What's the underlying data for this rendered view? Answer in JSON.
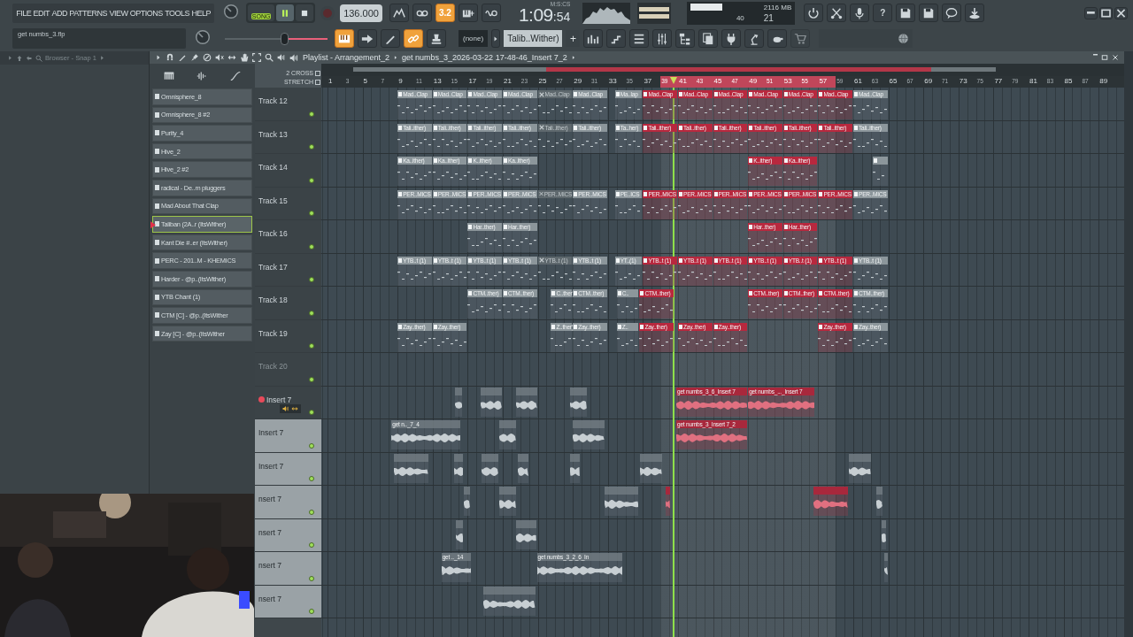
{
  "menu": [
    "FILE",
    "EDIT",
    "ADD",
    "PATTERNS",
    "VIEW",
    "OPTIONS",
    "TOOLS",
    "HELP"
  ],
  "hint_panel": {
    "text": "get numbs_3.flp"
  },
  "transport": {
    "song_label": "SONG",
    "song_mode": true,
    "playing": true,
    "recording": false,
    "tempo": "136.000"
  },
  "toolbar_top": [
    {
      "kind": "graph",
      "on": false
    },
    {
      "kind": "tape",
      "on": false
    },
    {
      "kind": "text",
      "label": "3.2",
      "on": true
    },
    {
      "kind": "keys",
      "on": false
    },
    {
      "kind": "wave",
      "on": false
    }
  ],
  "clock": {
    "time": "1:09",
    "seconds": ":54",
    "unit": "M:S:CS"
  },
  "monitor": {
    "polyphony": "40",
    "memory": "2116 MB",
    "cpu": "21"
  },
  "toolbar_right": [
    {
      "kind": "refresh"
    },
    {
      "kind": "cut"
    },
    {
      "kind": "mic"
    },
    {
      "kind": "text",
      "label": "?"
    },
    {
      "kind": "disk"
    },
    {
      "kind": "disk"
    },
    {
      "kind": "chat"
    },
    {
      "kind": "download"
    }
  ],
  "master_slider": {
    "level": 0.58
  },
  "toolbar_second": [
    {
      "kind": "piano",
      "on": true
    },
    {
      "kind": "arrow",
      "on": false
    },
    {
      "kind": "pencil",
      "on": false
    },
    {
      "kind": "link",
      "on": true
    },
    {
      "kind": "stamp",
      "on": false
    }
  ],
  "pattern_selector": {
    "value": "(none)"
  },
  "channel_selector": {
    "value": "Talib..Wither)",
    "add": "+"
  },
  "browser": {
    "title": "Browser - Snap 1"
  },
  "channels": [
    {
      "name": "Omnisphere_8",
      "selected": false
    },
    {
      "name": "Omnisphere_8 #2",
      "selected": false
    },
    {
      "name": "Purity_4",
      "selected": false
    },
    {
      "name": "Hive_2",
      "selected": false
    },
    {
      "name": "Hive_2 #2",
      "selected": false
    },
    {
      "name": "radical - De..m pluggers",
      "selected": false
    },
    {
      "name": "Mad About That Clap",
      "selected": false
    },
    {
      "name": "Taliban (2A..r (ItsWither)",
      "selected": true
    },
    {
      "name": "Kant Die #..er (ItsWither)",
      "selected": false
    },
    {
      "name": "PERC - 201..M - KHEMICS",
      "selected": false
    },
    {
      "name": "Harder - @p..(ItsWither)",
      "selected": false
    },
    {
      "name": "YTB Chant (1)",
      "selected": false
    },
    {
      "name": "CTM [C] - @p..(ItsWither",
      "selected": false
    },
    {
      "name": "Zay [C] - @p..(ItsWither",
      "selected": false
    }
  ],
  "playlist": {
    "title": "Playlist - Arrangement_2",
    "path": "get numbs_3_2026-03-22 17-48-46_Insert 7_2",
    "header_options": [
      {
        "label": "2 CROSS",
        "checked": false
      },
      {
        "label": "STRETCH",
        "checked": false
      }
    ],
    "ruler": [
      {
        "label": "1",
        "in_loop": false
      },
      {
        "label": "3",
        "in_loop": false
      },
      {
        "label": "5",
        "in_loop": false
      },
      {
        "label": "7",
        "in_loop": false
      },
      {
        "label": "9",
        "in_loop": false
      },
      {
        "label": "11",
        "in_loop": false
      },
      {
        "label": "13",
        "in_loop": false
      },
      {
        "label": "15",
        "in_loop": false
      },
      {
        "label": "17",
        "in_loop": false
      },
      {
        "label": "19",
        "in_loop": false
      },
      {
        "label": "21",
        "in_loop": false
      },
      {
        "label": "23",
        "in_loop": false
      },
      {
        "label": "25",
        "in_loop": false
      },
      {
        "label": "27",
        "in_loop": false
      },
      {
        "label": "29",
        "in_loop": false
      },
      {
        "label": "31",
        "in_loop": false
      },
      {
        "label": "33",
        "in_loop": false
      },
      {
        "label": "35",
        "in_loop": false
      },
      {
        "label": "37",
        "in_loop": false
      },
      {
        "label": "39",
        "in_loop": true
      },
      {
        "label": "41",
        "in_loop": true
      },
      {
        "label": "43",
        "in_loop": true
      },
      {
        "label": "45",
        "in_loop": true
      },
      {
        "label": "47",
        "in_loop": true
      },
      {
        "label": "49",
        "in_loop": true
      },
      {
        "label": "51",
        "in_loop": true
      },
      {
        "label": "53",
        "in_loop": true
      },
      {
        "label": "55",
        "in_loop": true
      },
      {
        "label": "57",
        "in_loop": true
      },
      {
        "label": "59",
        "in_loop": false
      },
      {
        "label": "61",
        "in_loop": false
      },
      {
        "label": "63",
        "in_loop": false
      },
      {
        "label": "65",
        "in_loop": false
      },
      {
        "label": "67",
        "in_loop": false
      },
      {
        "label": "69",
        "in_loop": false
      },
      {
        "label": "71",
        "in_loop": false
      },
      {
        "label": "73",
        "in_loop": false
      },
      {
        "label": "75",
        "in_loop": false
      },
      {
        "label": "77",
        "in_loop": false
      },
      {
        "label": "79",
        "in_loop": false
      },
      {
        "label": "81",
        "in_loop": false
      },
      {
        "label": "83",
        "in_loop": false
      },
      {
        "label": "85",
        "in_loop": false
      },
      {
        "label": "87",
        "in_loop": false
      },
      {
        "label": "89",
        "in_loop": false
      }
    ],
    "tracks": [
      {
        "name": "Track 12",
        "kind": "pattern",
        "enabled": true,
        "selected": false,
        "armed": false,
        "clips": [
          {
            "label": "Mad..Clap",
            "selected": false,
            "muted": false
          },
          {
            "label": "Mad..Clap",
            "selected": false,
            "muted": false
          },
          {
            "label": "Mad..Clap",
            "selected": false,
            "muted": false
          },
          {
            "label": "Mad..Clap",
            "selected": false,
            "muted": false
          },
          {
            "label": "Mad..Clap",
            "selected": false,
            "muted": true
          },
          {
            "label": "Mad..Clap",
            "selected": false,
            "muted": false
          },
          {
            "label": "Ma..lap",
            "selected": false,
            "muted": false
          },
          {
            "label": "Mad..Clap",
            "selected": true,
            "muted": false
          },
          {
            "label": "Mad..Clap",
            "selected": true,
            "muted": false
          },
          {
            "label": "Mad..Clap",
            "selected": true,
            "muted": false
          },
          {
            "label": "Mad..Clap",
            "selected": true,
            "muted": false
          },
          {
            "label": "Mad..Clap",
            "selected": true,
            "muted": false
          },
          {
            "label": "Mad..Clap",
            "selected": true,
            "muted": false
          },
          {
            "label": "Mad..Clap",
            "selected": false,
            "muted": false
          }
        ]
      },
      {
        "name": "Track 13",
        "kind": "pattern",
        "enabled": true,
        "selected": false,
        "armed": false,
        "clips": [
          {
            "label": "Tali..ither)",
            "selected": false,
            "muted": false
          },
          {
            "label": "Tali..ither)",
            "selected": false,
            "muted": false
          },
          {
            "label": "Tali..ither)",
            "selected": false,
            "muted": false
          },
          {
            "label": "Tali..ither)",
            "selected": false,
            "muted": false
          },
          {
            "label": "Tali..ither)",
            "selected": false,
            "muted": true
          },
          {
            "label": "Tali..ither)",
            "selected": false,
            "muted": false
          },
          {
            "label": "Ta..her)",
            "selected": false,
            "muted": false
          },
          {
            "label": "Tali..ither)",
            "selected": true,
            "muted": false
          },
          {
            "label": "Tali..ither)",
            "selected": true,
            "muted": false
          },
          {
            "label": "Tali..ither)",
            "selected": true,
            "muted": false
          },
          {
            "label": "Tali..ither)",
            "selected": true,
            "muted": false
          },
          {
            "label": "Tali..ither)",
            "selected": true,
            "muted": false
          },
          {
            "label": "Tali..ither)",
            "selected": true,
            "muted": false
          },
          {
            "label": "Tali..ither)",
            "selected": false,
            "muted": false
          }
        ]
      },
      {
        "name": "Track 14",
        "kind": "pattern",
        "enabled": true,
        "selected": false,
        "armed": false,
        "clips": [
          {
            "label": "Ka..ither)",
            "selected": false,
            "muted": false
          },
          {
            "label": "Ka..ither)",
            "selected": false,
            "muted": false
          },
          {
            "label": "K..ither)",
            "selected": false,
            "muted": false
          },
          {
            "label": "Ka..ither)",
            "selected": false,
            "muted": false
          },
          {
            "label": "K..ither)",
            "selected": true,
            "muted": false
          },
          {
            "label": "Ka..ither)",
            "selected": true,
            "muted": false
          },
          {
            "selected": false,
            "muted": false
          }
        ]
      },
      {
        "name": "Track 15",
        "kind": "pattern",
        "enabled": true,
        "selected": false,
        "armed": false,
        "clips": [
          {
            "label": "PER..MICS",
            "selected": false,
            "muted": false
          },
          {
            "label": "PER..MICS",
            "selected": false,
            "muted": false
          },
          {
            "label": "PER..MICS",
            "selected": false,
            "muted": false
          },
          {
            "label": "PER..MICS",
            "selected": false,
            "muted": false
          },
          {
            "label": "PER..MICS",
            "selected": false,
            "muted": true
          },
          {
            "label": "PER..MICS",
            "selected": false,
            "muted": false
          },
          {
            "label": "PE..ICS",
            "selected": false,
            "muted": false
          },
          {
            "label": "PER..MICS",
            "selected": true,
            "muted": false
          },
          {
            "label": "PER..MICS",
            "selected": true,
            "muted": false
          },
          {
            "label": "PER..MICS",
            "selected": true,
            "muted": false
          },
          {
            "label": "PER..MICS",
            "selected": true,
            "muted": false
          },
          {
            "label": "PER..MICS",
            "selected": true,
            "muted": false
          },
          {
            "label": "PER..MICS",
            "selected": true,
            "muted": false
          },
          {
            "label": "PER..MICS",
            "selected": false,
            "muted": false
          }
        ]
      },
      {
        "name": "Track 16",
        "kind": "pattern",
        "enabled": true,
        "selected": false,
        "armed": false,
        "clips": [
          {
            "label": "Har..ther)",
            "selected": false,
            "muted": false
          },
          {
            "label": "Har..ther)",
            "selected": false,
            "muted": false
          },
          {
            "label": "Har..ther)",
            "selected": true,
            "muted": false
          },
          {
            "label": "Har..ther)",
            "selected": true,
            "muted": false
          }
        ]
      },
      {
        "name": "Track 17",
        "kind": "pattern",
        "enabled": true,
        "selected": false,
        "armed": false,
        "clips": [
          {
            "label": "YTB..t (1)",
            "selected": false,
            "muted": false
          },
          {
            "label": "YTB..t (1)",
            "selected": false,
            "muted": false
          },
          {
            "label": "YTB..t (1)",
            "selected": false,
            "muted": false
          },
          {
            "label": "YTB..t (1)",
            "selected": false,
            "muted": false
          },
          {
            "label": "YTB..t (1)",
            "selected": false,
            "muted": true
          },
          {
            "label": "YTB..t (1)",
            "selected": false,
            "muted": false
          },
          {
            "label": "YT..(1)",
            "selected": false,
            "muted": false
          },
          {
            "label": "YTB..t (1)",
            "selected": true,
            "muted": false
          },
          {
            "label": "YTB..t (1)",
            "selected": true,
            "muted": false
          },
          {
            "label": "YTB..t (1)",
            "selected": true,
            "muted": false
          },
          {
            "label": "YTB..t (1)",
            "selected": true,
            "muted": false
          },
          {
            "label": "YTB..t (1)",
            "selected": true,
            "muted": false
          },
          {
            "label": "YTB..t (1)",
            "selected": true,
            "muted": false
          },
          {
            "label": "YTB..t (1)",
            "selected": false,
            "muted": false
          }
        ]
      },
      {
        "name": "Track 18",
        "kind": "pattern",
        "enabled": true,
        "selected": false,
        "armed": false,
        "clips": [
          {
            "label": "CTM..ther)",
            "selected": false,
            "muted": false
          },
          {
            "label": "CTM..ther)",
            "selected": false,
            "muted": false
          },
          {
            "label": "C..ther)",
            "selected": false,
            "muted": false
          },
          {
            "label": "CTM..ther)",
            "selected": false,
            "muted": false
          },
          {
            "label": "C..",
            "selected": false,
            "muted": false
          },
          {
            "label": "CTM..ther)",
            "selected": true,
            "muted": false
          },
          {
            "label": "CTM..ther)",
            "selected": true,
            "muted": false
          },
          {
            "label": "CTM..ther)",
            "selected": true,
            "muted": false
          },
          {
            "label": "CTM..ther)",
            "selected": true,
            "muted": false
          },
          {
            "label": "CTM..ther)",
            "selected": false,
            "muted": false
          }
        ]
      },
      {
        "name": "Track 19",
        "kind": "pattern",
        "enabled": true,
        "selected": false,
        "armed": false,
        "clips": [
          {
            "label": "Zay..ther)",
            "selected": false,
            "muted": false
          },
          {
            "label": "Zay..ther)",
            "selected": false,
            "muted": false
          },
          {
            "label": "Z..ther)",
            "selected": false,
            "muted": false
          },
          {
            "label": "Zay..ther)",
            "selected": false,
            "muted": false
          },
          {
            "label": "Z..",
            "selected": false,
            "muted": false
          },
          {
            "label": "Zay..ther)",
            "selected": true,
            "muted": false
          },
          {
            "label": "Zay..ther)",
            "selected": true,
            "muted": false
          },
          {
            "label": "Zay..ther)",
            "selected": true,
            "muted": false
          },
          {
            "label": "Zay..ther)",
            "selected": true,
            "muted": false
          },
          {
            "label": "Zay..ther)",
            "selected": false,
            "muted": false
          }
        ]
      },
      {
        "name": "Track 20",
        "enabled": false,
        "selected": false,
        "armed": false
      },
      {
        "name": "Insert 7",
        "kind": "audio",
        "enabled": true,
        "selected": false,
        "armed": true,
        "clips": [
          {
            "selected": false,
            "muted": false
          },
          {
            "selected": false,
            "muted": false
          },
          {
            "selected": false,
            "muted": false
          },
          {
            "selected": false,
            "muted": false
          },
          {
            "label": "get numbs_3_6_Insert 7",
            "selected": true,
            "muted": false
          },
          {
            "label": "get numbs_..._Insert 7",
            "selected": true,
            "muted": false
          }
        ]
      },
      {
        "name": "Insert 7",
        "kind": "audio",
        "enabled": true,
        "selected": true,
        "armed": false,
        "clips": [
          {
            "label": "get n.._7_4",
            "selected": false,
            "muted": false
          },
          {
            "selected": false,
            "muted": false
          },
          {
            "selected": false,
            "muted": false
          },
          {
            "label": "get numbs_3_Insert 7_2",
            "selected": true,
            "muted": false
          }
        ]
      },
      {
        "name": "Insert 7",
        "kind": "audio",
        "enabled": true,
        "selected": true,
        "armed": false,
        "clips": [
          {
            "selected": false,
            "muted": false
          },
          {
            "selected": false,
            "muted": false
          },
          {
            "selected": false,
            "muted": false
          },
          {
            "selected": false,
            "muted": false
          },
          {
            "selected": false,
            "muted": false
          },
          {
            "selected": false,
            "muted": false
          },
          {
            "selected": false,
            "muted": false
          }
        ]
      },
      {
        "name": "nsert 7",
        "kind": "audio",
        "enabled": true,
        "selected": true,
        "armed": false,
        "clips": [
          {
            "selected": false,
            "muted": false
          },
          {
            "selected": false,
            "muted": false
          },
          {
            "selected": false,
            "muted": false
          },
          {
            "selected": true,
            "muted": false
          },
          {
            "selected": true,
            "muted": false
          },
          {
            "selected": false,
            "muted": false
          }
        ]
      },
      {
        "name": "nsert 7",
        "kind": "audio",
        "enabled": true,
        "selected": true,
        "armed": false,
        "clips": [
          {
            "selected": false,
            "muted": false
          },
          {
            "selected": false,
            "muted": false
          },
          {
            "selected": false,
            "muted": false
          }
        ]
      },
      {
        "name": "nsert 7",
        "kind": "audio",
        "enabled": true,
        "selected": true,
        "armed": false,
        "clips": [
          {
            "label": "get .._14",
            "selected": false,
            "muted": false
          },
          {
            "label": "get numbs_3_2_6_In",
            "selected": false,
            "muted": false
          },
          {
            "selected": false,
            "muted": false
          }
        ]
      },
      {
        "name": "nsert 7",
        "kind": "audio",
        "enabled": true,
        "selected": true,
        "armed": false,
        "clips": [
          {
            "selected": false,
            "muted": false
          }
        ]
      }
    ]
  }
}
